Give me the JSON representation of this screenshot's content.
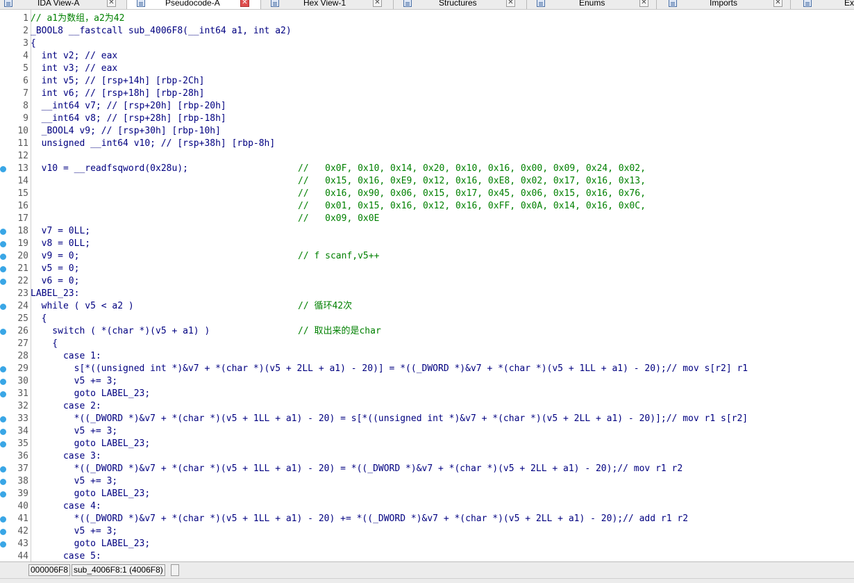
{
  "tabs": [
    {
      "label": "IDA View-A",
      "icon": "ida-view-icon",
      "active": false
    },
    {
      "label": "Pseudocode-A",
      "icon": "pseudocode-icon",
      "active": true
    },
    {
      "label": "Hex View-1",
      "icon": "hex-view-icon",
      "active": false
    },
    {
      "label": "Structures",
      "icon": "structures-icon",
      "active": false
    },
    {
      "label": "Enums",
      "icon": "enums-icon",
      "active": false
    },
    {
      "label": "Imports",
      "icon": "imports-icon",
      "active": false
    },
    {
      "label": "Ex",
      "icon": "exports-icon",
      "active": false
    }
  ],
  "close_glyph": "✕",
  "code_lines": [
    {
      "n": "1",
      "dot": false,
      "code": "",
      "comment": "// a1为数组，a2为42"
    },
    {
      "n": "2",
      "dot": false,
      "code": "_BOOL8 __fastcall sub_4006F8(__int64 a1, int a2)",
      "comment": ""
    },
    {
      "n": "3",
      "dot": false,
      "code": "{",
      "comment": ""
    },
    {
      "n": "4",
      "dot": false,
      "code": "  int v2; // eax",
      "comment": ""
    },
    {
      "n": "5",
      "dot": false,
      "code": "  int v3; // eax",
      "comment": ""
    },
    {
      "n": "6",
      "dot": false,
      "code": "  int v5; // [rsp+14h] [rbp-2Ch]",
      "comment": ""
    },
    {
      "n": "7",
      "dot": false,
      "code": "  int v6; // [rsp+18h] [rbp-28h]",
      "comment": ""
    },
    {
      "n": "8",
      "dot": false,
      "code": "  __int64 v7; // [rsp+20h] [rbp-20h]",
      "comment": ""
    },
    {
      "n": "9",
      "dot": false,
      "code": "  __int64 v8; // [rsp+28h] [rbp-18h]",
      "comment": ""
    },
    {
      "n": "10",
      "dot": false,
      "code": "  _BOOL4 v9; // [rsp+30h] [rbp-10h]",
      "comment": ""
    },
    {
      "n": "11",
      "dot": false,
      "code": "  unsigned __int64 v10; // [rsp+38h] [rbp-8h]",
      "comment": ""
    },
    {
      "n": "12",
      "dot": false,
      "code": "",
      "comment": ""
    },
    {
      "n": "13",
      "dot": true,
      "code": "  v10 = __readfsqword(0x28u);",
      "comment": "//   0x0F, 0x10, 0x14, 0x20, 0x10, 0x16, 0x00, 0x09, 0x24, 0x02,"
    },
    {
      "n": "14",
      "dot": false,
      "code": "",
      "comment": "//   0x15, 0x16, 0xE9, 0x12, 0x16, 0xE8, 0x02, 0x17, 0x16, 0x13,"
    },
    {
      "n": "15",
      "dot": false,
      "code": "",
      "comment": "//   0x16, 0x90, 0x06, 0x15, 0x17, 0x45, 0x06, 0x15, 0x16, 0x76,"
    },
    {
      "n": "16",
      "dot": false,
      "code": "",
      "comment": "//   0x01, 0x15, 0x16, 0x12, 0x16, 0xFF, 0x0A, 0x14, 0x16, 0x0C,"
    },
    {
      "n": "17",
      "dot": false,
      "code": "",
      "comment": "//   0x09, 0x0E"
    },
    {
      "n": "18",
      "dot": true,
      "code": "  v7 = 0LL;",
      "comment": ""
    },
    {
      "n": "19",
      "dot": true,
      "code": "  v8 = 0LL;",
      "comment": ""
    },
    {
      "n": "20",
      "dot": true,
      "code": "  v9 = 0;",
      "comment": "// f scanf,v5++"
    },
    {
      "n": "21",
      "dot": true,
      "code": "  v5 = 0;",
      "comment": ""
    },
    {
      "n": "22",
      "dot": true,
      "code": "  v6 = 0;",
      "comment": ""
    },
    {
      "n": "23",
      "dot": false,
      "code": "LABEL_23:",
      "comment": ""
    },
    {
      "n": "24",
      "dot": true,
      "code": "  while ( v5 < a2 )",
      "comment": "// 循环42次"
    },
    {
      "n": "25",
      "dot": false,
      "code": "  {",
      "comment": ""
    },
    {
      "n": "26",
      "dot": true,
      "code": "    switch ( *(char *)(v5 + a1) )",
      "comment": "// 取出来的是char"
    },
    {
      "n": "27",
      "dot": false,
      "code": "    {",
      "comment": ""
    },
    {
      "n": "28",
      "dot": false,
      "code": "      case 1:",
      "comment": ""
    },
    {
      "n": "29",
      "dot": true,
      "code": "        s[*((unsigned int *)&v7 + *(char *)(v5 + 2LL + a1) - 20)] = *((_DWORD *)&v7 + *(char *)(v5 + 1LL + a1) - 20);// mov s[r2] r1",
      "comment": ""
    },
    {
      "n": "30",
      "dot": true,
      "code": "        v5 += 3;",
      "comment": ""
    },
    {
      "n": "31",
      "dot": true,
      "code": "        goto LABEL_23;",
      "comment": ""
    },
    {
      "n": "32",
      "dot": false,
      "code": "      case 2:",
      "comment": ""
    },
    {
      "n": "33",
      "dot": true,
      "code": "        *((_DWORD *)&v7 + *(char *)(v5 + 1LL + a1) - 20) = s[*((unsigned int *)&v7 + *(char *)(v5 + 2LL + a1) - 20)];// mov r1 s[r2]",
      "comment": ""
    },
    {
      "n": "34",
      "dot": true,
      "code": "        v5 += 3;",
      "comment": ""
    },
    {
      "n": "35",
      "dot": true,
      "code": "        goto LABEL_23;",
      "comment": ""
    },
    {
      "n": "36",
      "dot": false,
      "code": "      case 3:",
      "comment": ""
    },
    {
      "n": "37",
      "dot": true,
      "code": "        *((_DWORD *)&v7 + *(char *)(v5 + 1LL + a1) - 20) = *((_DWORD *)&v7 + *(char *)(v5 + 2LL + a1) - 20);// mov r1 r2",
      "comment": ""
    },
    {
      "n": "38",
      "dot": true,
      "code": "        v5 += 3;",
      "comment": ""
    },
    {
      "n": "39",
      "dot": true,
      "code": "        goto LABEL_23;",
      "comment": ""
    },
    {
      "n": "40",
      "dot": false,
      "code": "      case 4:",
      "comment": ""
    },
    {
      "n": "41",
      "dot": true,
      "code": "        *((_DWORD *)&v7 + *(char *)(v5 + 1LL + a1) - 20) += *((_DWORD *)&v7 + *(char *)(v5 + 2LL + a1) - 20);// add r1 r2",
      "comment": ""
    },
    {
      "n": "42",
      "dot": true,
      "code": "        v5 += 3;",
      "comment": ""
    },
    {
      "n": "43",
      "dot": true,
      "code": "        goto LABEL_23;",
      "comment": ""
    },
    {
      "n": "44",
      "dot": false,
      "code": "      case 5:",
      "comment": ""
    }
  ],
  "status": {
    "address": "000006F8",
    "location": "sub_4006F8:1 (4006F8)"
  }
}
